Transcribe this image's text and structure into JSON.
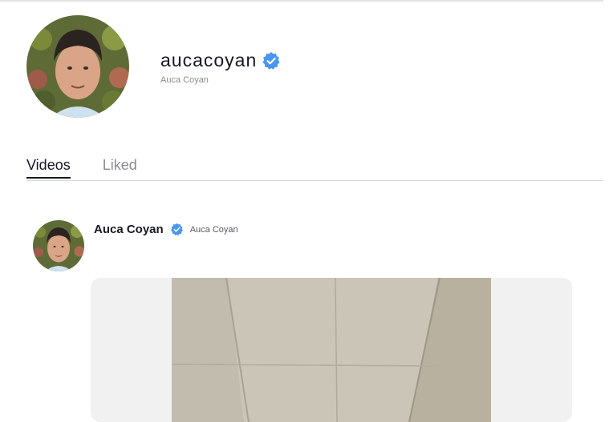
{
  "profile": {
    "username": "aucacoyan",
    "display_name": "Auca Coyan",
    "verified": true,
    "verified_icon": "verified-badge-icon"
  },
  "tabs": [
    {
      "label": "Videos",
      "active": true
    },
    {
      "label": "Liked",
      "active": false
    }
  ],
  "post": {
    "author": "Auca Coyan",
    "handle": "Auca Coyan",
    "verified": true
  },
  "colors": {
    "accent_verified": "#4a96f3",
    "text_primary": "#161823",
    "text_secondary": "#8a8b91",
    "card_background": "#f1f1f2"
  }
}
